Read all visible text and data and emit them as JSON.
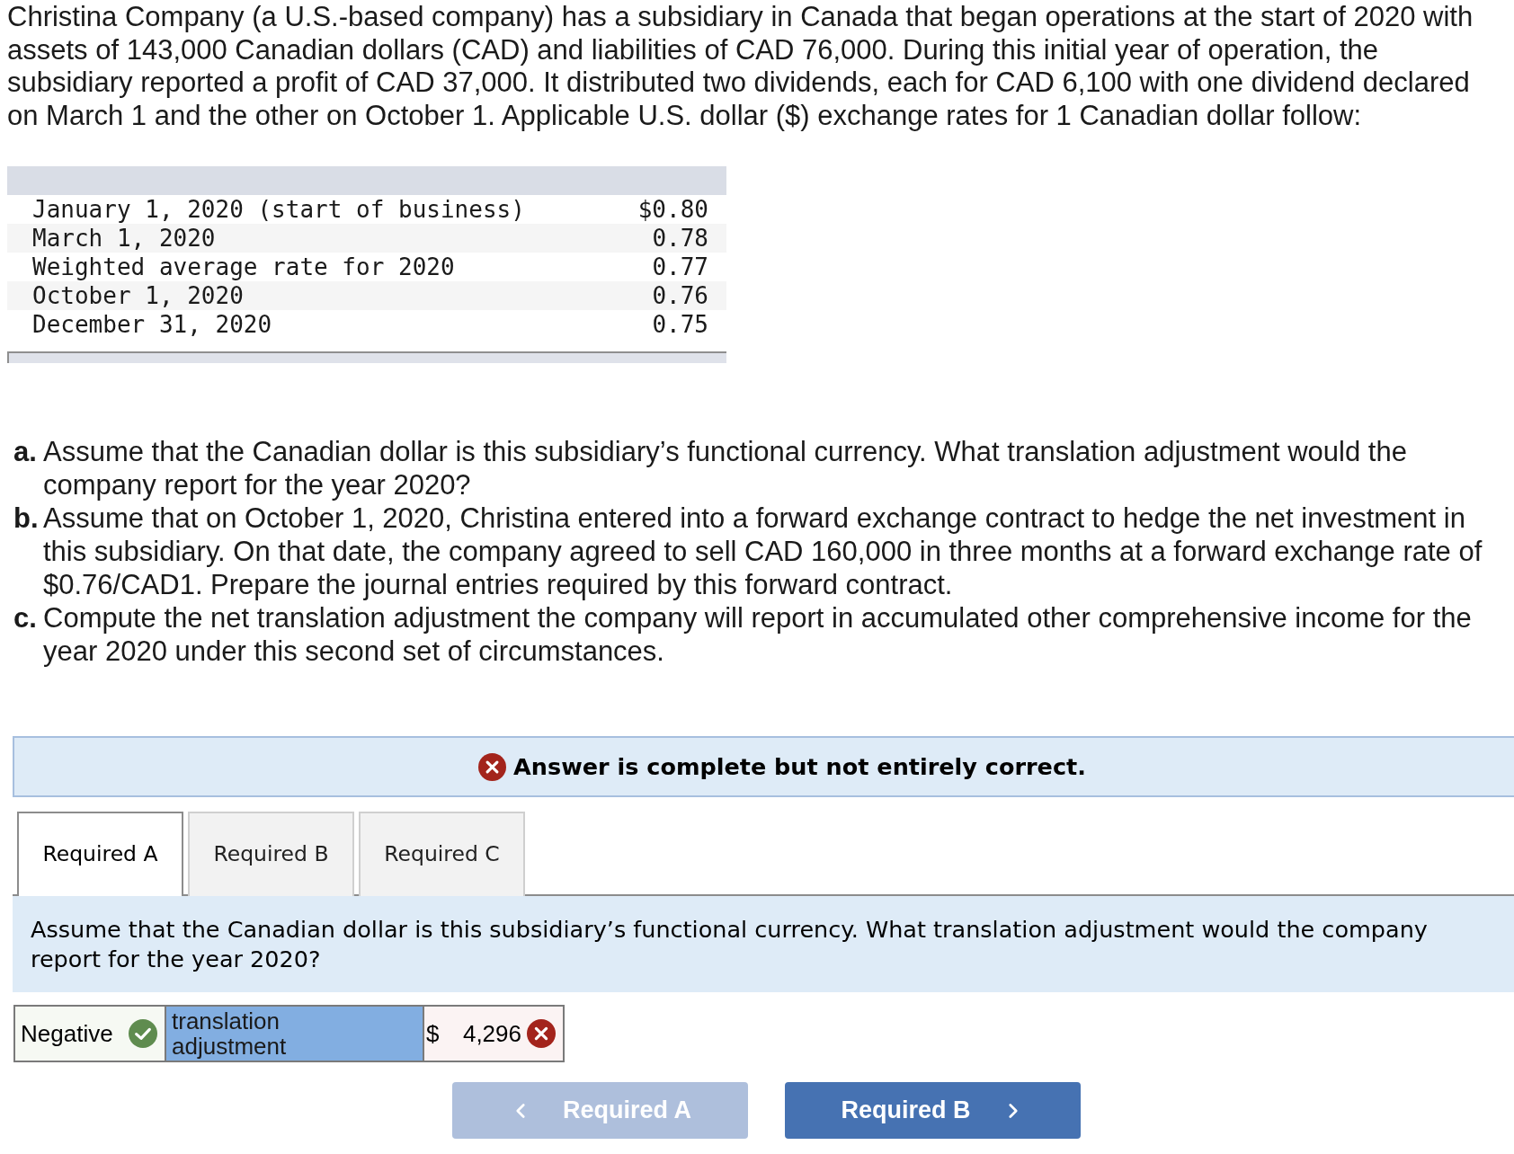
{
  "intro": "Christina Company (a U.S.-based company) has a subsidiary in Canada that began operations at the start of 2020 with assets of 143,000 Canadian dollars (CAD) and liabilities of CAD 76,000. During this initial year of operation, the subsidiary reported a profit of CAD 37,000. It distributed two dividends, each for CAD 6,100 with one dividend declared on March 1 and the other on October 1. Applicable U.S. dollar ($) exchange rates for 1 Canadian dollar follow:",
  "rates_table": {
    "rows": [
      {
        "label": "January 1, 2020 (start of business)",
        "value": "$0.80"
      },
      {
        "label": "March 1, 2020",
        "value": "0.78"
      },
      {
        "label": "Weighted average rate for 2020",
        "value": "0.77"
      },
      {
        "label": "October 1, 2020",
        "value": "0.76"
      },
      {
        "label": "December 31, 2020",
        "value": "0.75"
      }
    ]
  },
  "questions": [
    {
      "marker": "a.",
      "text": "Assume that the Canadian dollar is this subsidiary’s functional currency. What translation adjustment would the company report for the year 2020?"
    },
    {
      "marker": "b.",
      "text": "Assume that on October 1, 2020, Christina entered into a forward exchange contract to hedge the net investment in this subsidiary. On that date, the company agreed to sell CAD 160,000 in three months at a forward exchange rate of $0.76/CAD1. Prepare the journal entries required by this forward contract."
    },
    {
      "marker": "c.",
      "text": "Compute the net translation adjustment the company will report in accumulated other comprehensive income for the year 2020 under this second set of circumstances."
    }
  ],
  "feedback_banner": {
    "correct": false,
    "text": "Answer is complete but not entirely correct."
  },
  "tabs": [
    {
      "label": "Required A",
      "selected": true
    },
    {
      "label": "Required B",
      "selected": false
    },
    {
      "label": "Required C",
      "selected": false
    }
  ],
  "prompt": "Assume that the Canadian dollar is this subsidiary’s functional currency. What translation adjustment would the company report for the year 2020?",
  "answer_row": {
    "sign": {
      "value": "Negative",
      "correct": true
    },
    "label": "translation adjustment",
    "amount": {
      "currency": "$",
      "value": "4,296",
      "correct": false
    }
  },
  "nav": {
    "prev": {
      "label": "Required A",
      "disabled": true
    },
    "next": {
      "label": "Required B",
      "disabled": false
    }
  }
}
